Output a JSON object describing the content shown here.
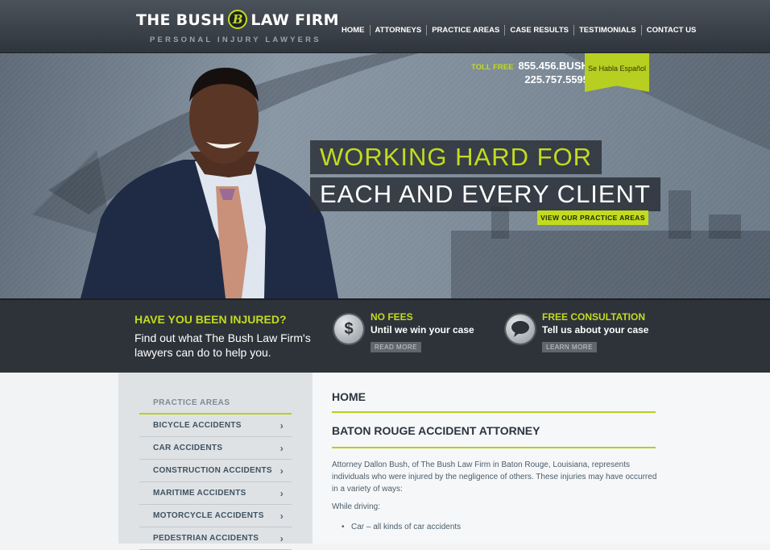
{
  "header": {
    "logo_text_left": "THE BUSH",
    "logo_monogram": "B",
    "logo_text_right": "LAW FIRM",
    "tagline": "PERSONAL INJURY LAWYERS",
    "nav": [
      "HOME",
      "ATTORNEYS",
      "PRACTICE AREAS",
      "CASE RESULTS",
      "TESTIMONIALS",
      "CONTACT US"
    ]
  },
  "hero": {
    "toll_free_label": "TOLL FREE",
    "phone_1": "855.456.BUSH",
    "phone_2": "225.757.5595",
    "spanish_badge": "Se Habla Español",
    "headline_1": "WORKING HARD FOR",
    "headline_2": "EACH AND EVERY CLIENT",
    "cta": "VIEW OUR PRACTICE AREAS"
  },
  "band": {
    "title": "HAVE YOU BEEN INJURED?",
    "text": "Find out what The Bush Law Firm's lawyers can do to help you.",
    "features": [
      {
        "icon": "dollar-icon",
        "glyph": "$",
        "title": "NO FEES",
        "subtitle": "Until we win your case",
        "button": "READ MORE"
      },
      {
        "icon": "speech-bubble-icon",
        "glyph": "💬",
        "title": "FREE CONSULTATION",
        "subtitle": "Tell us about your case",
        "button": "LEARN MORE"
      }
    ]
  },
  "sidebar": {
    "title": "PRACTICE AREAS",
    "items": [
      "BICYCLE ACCIDENTS",
      "CAR ACCIDENTS",
      "CONSTRUCTION ACCIDENTS",
      "MARITIME ACCIDENTS",
      "MOTORCYCLE ACCIDENTS",
      "PEDESTRIAN ACCIDENTS"
    ],
    "chevron": "›"
  },
  "main": {
    "breadcrumb": "HOME",
    "heading": "BATON ROUGE ACCIDENT ATTORNEY",
    "paragraph": "Attorney Dallon Bush, of The Bush Law Firm in Baton Rouge, Louisiana, represents individuals who were injured by the negligence of others. These injuries may have occurred in a variety of ways:",
    "while_driving": "While driving:",
    "bullet_1": "Car – all kinds of car accidents"
  },
  "colors": {
    "accent": "#c2db1f",
    "dark": "#2e333a"
  }
}
